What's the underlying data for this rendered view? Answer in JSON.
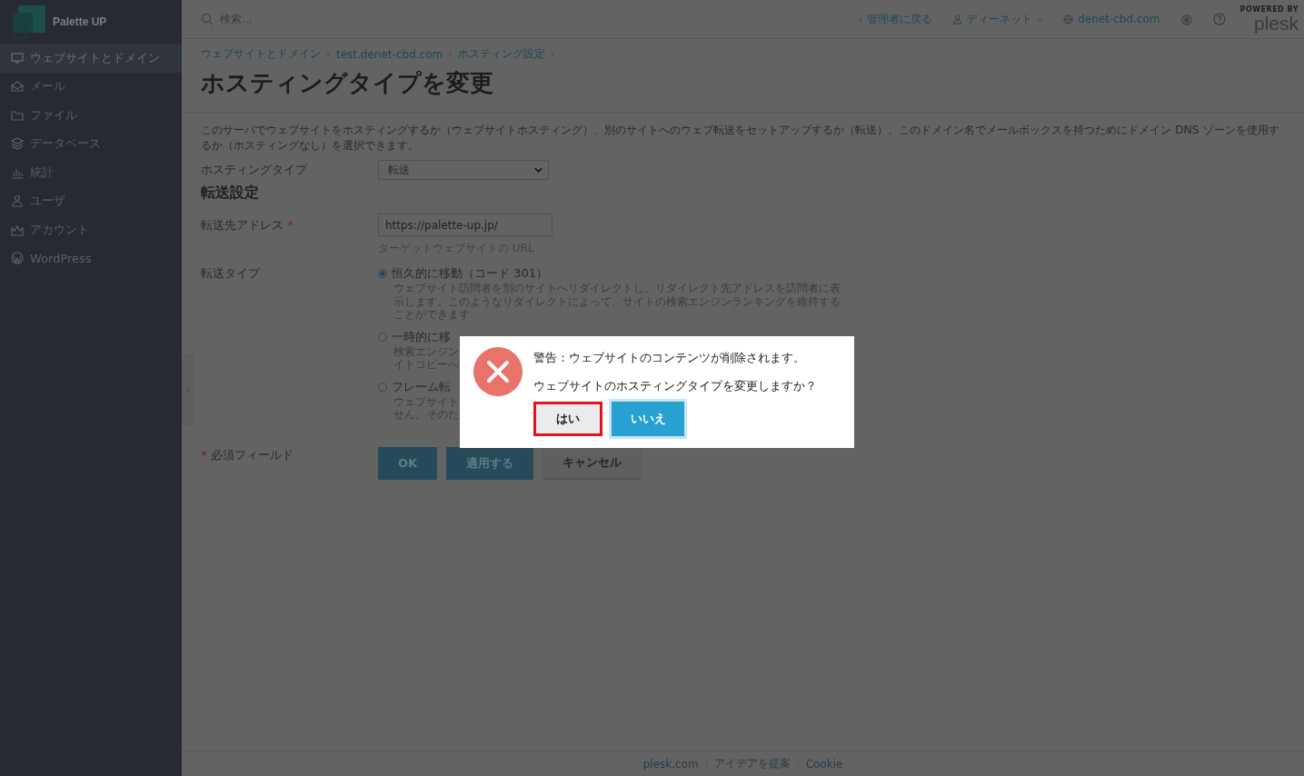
{
  "brand": {
    "name": "Palette UP"
  },
  "sidebar": {
    "items": [
      {
        "kind": "monitor",
        "label": "ウェブサイトとドメイン",
        "selected": true
      },
      {
        "kind": "mail",
        "label": "メール",
        "selected": false
      },
      {
        "kind": "folder",
        "label": "ファイル",
        "selected": false
      },
      {
        "kind": "layers",
        "label": "データベース",
        "selected": false
      },
      {
        "kind": "chart",
        "label": "統計",
        "selected": false
      },
      {
        "kind": "user",
        "label": "ユーザ",
        "selected": false
      },
      {
        "kind": "crown",
        "label": "アカウント",
        "selected": false
      },
      {
        "kind": "wordpress",
        "label": "WordPress",
        "selected": false
      }
    ]
  },
  "topbar": {
    "search": {
      "placeholder": "検索..."
    },
    "links": [
      {
        "kind": "back",
        "label": "管理者に戻る"
      },
      {
        "kind": "user",
        "label": "ディーネット"
      },
      {
        "kind": "domain",
        "label": "denet-cbd.com"
      }
    ],
    "powered": "POWERED BY",
    "logo": "plesk"
  },
  "breadcrumbs": [
    "ウェブサイトとドメイン",
    "test.denet-cbd.com",
    "ホスティング設定"
  ],
  "title": "ホスティングタイプを変更",
  "description": "このサーバでウェブサイトをホスティングするか（ウェブサイトホスティング）、別のサイトへのウェブ転送をセットアップするか（転送）、このドメイン名でメールボックスを持つためにドメイン DNS ゾーンを使用するか（ホスティングなし）を選択できます。",
  "form": {
    "hosting_type": {
      "label": "ホスティングタイプ",
      "value": "転送"
    },
    "section": "転送設定",
    "address": {
      "label": "転送先アドレス",
      "required_mark": "*",
      "value": "https://palette-up.jp/",
      "hint": "ターゲットウェブサイトの URL"
    },
    "redirect_type": {
      "label": "転送タイプ",
      "options": [
        {
          "label": "恒久的に移動（コード 301）",
          "selected": true,
          "description": [
            "ウェブサイト訪問者を別のサイトへリダイレクトし、リダイレクト先アドレスを訪問者に表",
            "示します。このようなリダイレクトによって、サイトの検索エンジンランキングを維持する",
            "ことができます"
          ]
        },
        {
          "label": "一時的に移",
          "selected": false,
          "description": [
            "検索エンジン",
            "イトコピーへ"
          ]
        },
        {
          "label": "フレーム転",
          "selected": false,
          "description": [
            "ウェブサイト",
            "せん。そのた"
          ]
        }
      ]
    },
    "required_note": {
      "mark": "*",
      "text": "必須フィールド"
    },
    "buttons": [
      {
        "kind": "primary",
        "label": "OK"
      },
      {
        "kind": "primary",
        "label": "適用する"
      },
      {
        "kind": "secondary",
        "label": "キャンセル"
      }
    ]
  },
  "dialog": {
    "lines": [
      "警告：ウェブサイトのコンテンツが削除されます。",
      "ウェブサイトのホスティングタイプを変更しますか？"
    ],
    "buttons": [
      {
        "kind": "secondary",
        "label": "はい",
        "highlighted": true
      },
      {
        "kind": "primary",
        "label": "いいえ",
        "highlighted": false
      }
    ]
  },
  "footer": {
    "links": [
      "plesk.com",
      "アイデアを提案",
      "Cookie"
    ]
  }
}
